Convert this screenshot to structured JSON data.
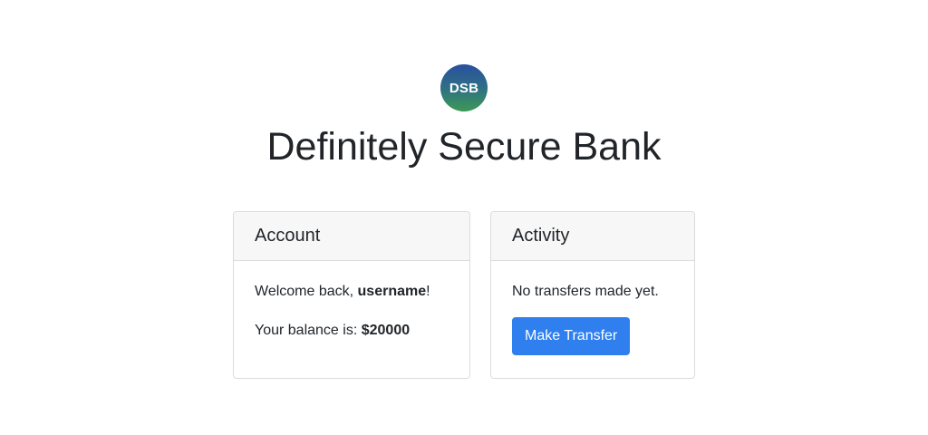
{
  "brand": {
    "logo_text": "DSB",
    "title": "Definitely Secure Bank",
    "gradient": [
      "#2a4f9e",
      "#3c9a54"
    ]
  },
  "account": {
    "header": "Account",
    "welcome_prefix": "Welcome back, ",
    "username": "username",
    "welcome_suffix": "!",
    "balance_label": "Your balance is: ",
    "balance_value": "$20000"
  },
  "activity": {
    "header": "Activity",
    "empty_message": "No transfers made yet.",
    "button_label": "Make Transfer",
    "button_color": "#2f7fee"
  }
}
